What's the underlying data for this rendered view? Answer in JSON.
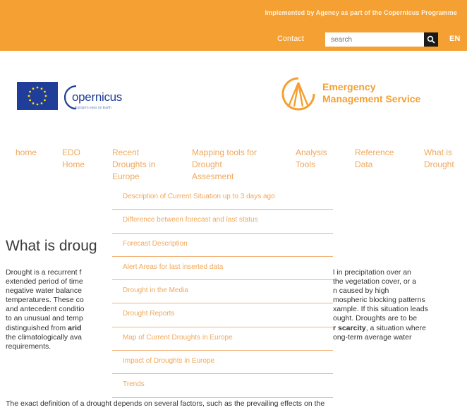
{
  "header": {
    "implemented_by": "Implemented by Agency as part of the Copernicus Programme",
    "contact": "Contact",
    "search_placeholder": "search",
    "language": "EN"
  },
  "logos": {
    "copernicus_word": "opernicus",
    "copernicus_tagline": "Europe's eyes on Earth",
    "ems_line1": "Emergency",
    "ems_line2": "Management Service"
  },
  "nav": {
    "home": [
      "home"
    ],
    "edo_home": [
      "EDO",
      "Home"
    ],
    "recent_droughts": [
      "Recent",
      "Droughts in",
      "Europe"
    ],
    "mapping_tools": [
      "Mapping tools for",
      "Drought",
      "Assesment"
    ],
    "analysis_tools": [
      "Analysis",
      "Tools"
    ],
    "reference_data": [
      "Reference",
      "Data"
    ],
    "what_is_drought": [
      "What is",
      "Drought"
    ]
  },
  "dropdown": [
    "Description of Current Situation up to 3 days ago",
    "Difference between forecast and last status",
    "Forecast Description",
    "Alert Areas for last inserted data",
    "Drought in the Media",
    "Drought Reports",
    "Map of Current Droughts in Europe",
    "Impact of Droughts in Europe",
    "Trends"
  ],
  "main": {
    "title": "What is droug",
    "para1_left": [
      "Drought is a recurrent f",
      "extended period of time",
      "negative water balance",
      "temperatures. These co",
      "and antecedent conditio",
      "to an unusual and temp",
      "distinguished from ",
      "the climatologically ava",
      "requirements."
    ],
    "para1_left_bold": "arid",
    "para1_right": [
      "l in precipitation over an",
      " the vegetation cover, or a",
      "n caused by high",
      "mospheric blocking patterns",
      "xample. If this situation leads",
      "ought. Droughts are to be",
      ", a situation where",
      "ong-term average water"
    ],
    "para1_right_bold": "r scarcity",
    "para2": "The exact definition of a drought depends on several factors, such as the prevailing effects on the"
  }
}
